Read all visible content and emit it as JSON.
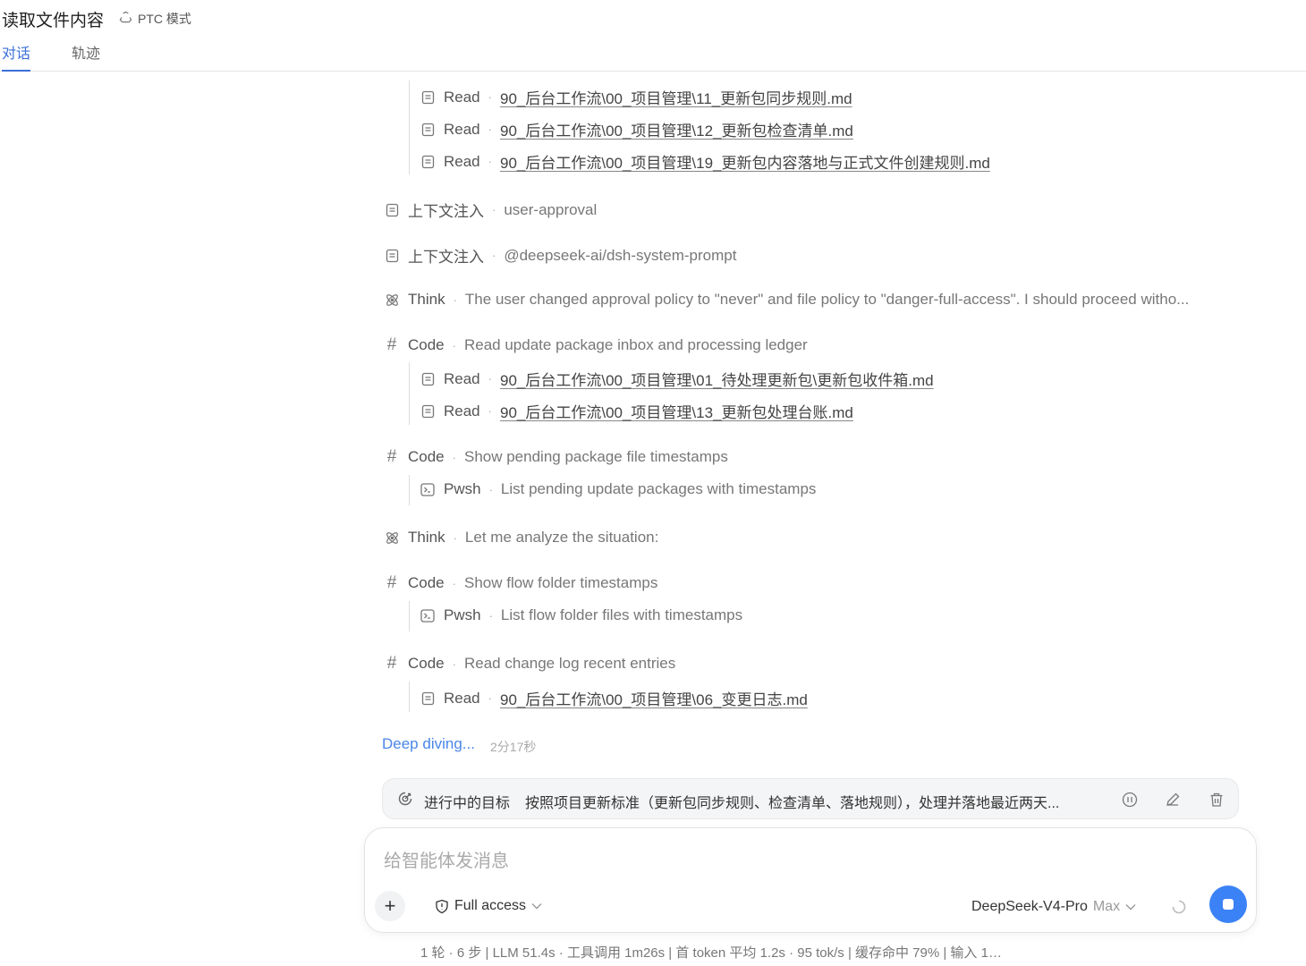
{
  "header": {
    "title": "读取文件内容",
    "mode": "PTC 模式",
    "tabs": [
      {
        "label": "对话",
        "active": true
      },
      {
        "label": "轨迹",
        "active": false
      }
    ]
  },
  "timeline": {
    "sub_reads_top": [
      {
        "kw": "Read",
        "file": "90_后台工作流\\00_项目管理\\11_更新包同步规则.md"
      },
      {
        "kw": "Read",
        "file": "90_后台工作流\\00_项目管理\\12_更新包检查清单.md"
      },
      {
        "kw": "Read",
        "file": "90_后台工作流\\00_项目管理\\19_更新包内容落地与正式文件创建规则.md"
      }
    ],
    "ctx1": {
      "kw": "上下文注入",
      "desc": "user-approval"
    },
    "ctx2": {
      "kw": "上下文注入",
      "desc": "@deepseek-ai/dsh-system-prompt"
    },
    "think1": {
      "kw": "Think",
      "desc": "The user changed approval policy to \"never\" and file policy to \"danger-full-access\". I should proceed witho..."
    },
    "code1": {
      "kw": "Code",
      "desc": "Read update package inbox and processing ledger"
    },
    "code1_reads": [
      {
        "kw": "Read",
        "file": "90_后台工作流\\00_项目管理\\01_待处理更新包\\更新包收件箱.md"
      },
      {
        "kw": "Read",
        "file": "90_后台工作流\\00_项目管理\\13_更新包处理台账.md"
      }
    ],
    "code2": {
      "kw": "Code",
      "desc": "Show pending package file timestamps"
    },
    "code2_pwsh": {
      "kw": "Pwsh",
      "desc": "List pending update packages with timestamps"
    },
    "think2": {
      "kw": "Think",
      "desc": "Let me analyze the situation:"
    },
    "code3": {
      "kw": "Code",
      "desc": "Show flow folder timestamps"
    },
    "code3_pwsh": {
      "kw": "Pwsh",
      "desc": "List flow folder files with timestamps"
    },
    "code4": {
      "kw": "Code",
      "desc": "Read change log recent entries"
    },
    "code4_read": {
      "kw": "Read",
      "file": "90_后台工作流\\00_项目管理\\06_变更日志.md"
    }
  },
  "status": {
    "label": "Deep diving...",
    "elapsed": "2分17秒"
  },
  "goal": {
    "label": "进行中的目标",
    "text": "按照项目更新标准（更新包同步规则、检查清单、落地规则），处理并落地最近两天..."
  },
  "composer": {
    "placeholder": "给智能体发消息",
    "access": "Full access",
    "model": "DeepSeek-V4-Pro",
    "effort": "Max"
  },
  "stats": "1 轮 · 6 步  |  LLM 51.4s · 工具调用 1m26s  |  首 token 平均 1.2s · 95 tok/s  |  缓存命中 79%  |  输入 1…"
}
